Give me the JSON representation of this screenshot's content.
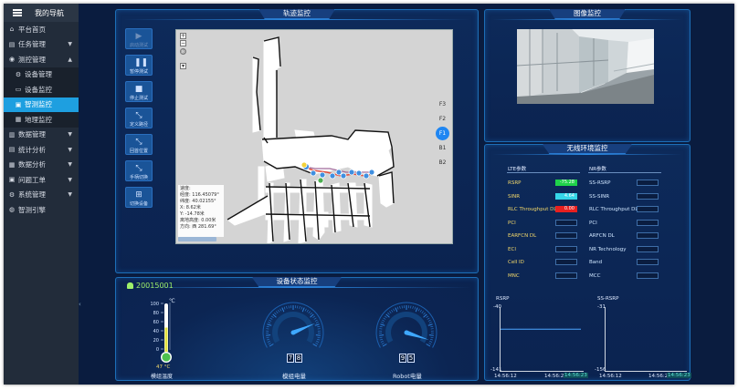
{
  "sidebar": {
    "title": "我的导航",
    "items": [
      {
        "label": "平台首页",
        "icon": "home-icon",
        "level": 0,
        "caret": false,
        "active": false
      },
      {
        "label": "任务管理",
        "icon": "task-icon",
        "level": 0,
        "caret": true,
        "caret_dir": "down",
        "active": false
      },
      {
        "label": "测控管理",
        "icon": "monitor-icon",
        "level": 0,
        "caret": true,
        "caret_dir": "up",
        "active": false
      },
      {
        "label": "设备管理",
        "icon": "device-icon",
        "level": 1,
        "caret": false,
        "active": false
      },
      {
        "label": "设备监控",
        "icon": "device-monitor-icon",
        "level": 1,
        "caret": false,
        "active": false
      },
      {
        "label": "智测监控",
        "icon": "smart-monitor-icon",
        "level": 1,
        "caret": false,
        "active": true
      },
      {
        "label": "地理监控",
        "icon": "geo-monitor-icon",
        "level": 1,
        "caret": false,
        "active": false
      },
      {
        "label": "数据管理",
        "icon": "data-icon",
        "level": 0,
        "caret": true,
        "caret_dir": "down",
        "active": false
      },
      {
        "label": "统计分析",
        "icon": "stats-icon",
        "level": 0,
        "caret": true,
        "caret_dir": "down",
        "active": false
      },
      {
        "label": "数据分析",
        "icon": "analysis-icon",
        "level": 0,
        "caret": true,
        "caret_dir": "down",
        "active": false
      },
      {
        "label": "问题工单",
        "icon": "ticket-icon",
        "level": 0,
        "caret": true,
        "caret_dir": "down",
        "active": false
      },
      {
        "label": "系统管理",
        "icon": "gear-icon",
        "level": 0,
        "caret": true,
        "caret_dir": "down",
        "active": false
      },
      {
        "label": "智测引擎",
        "icon": "engine-icon",
        "level": 0,
        "caret": false,
        "active": false
      }
    ]
  },
  "track_panel": {
    "title": "轨迹监控",
    "buttons": [
      {
        "label": "启动测试",
        "icon": "play-icon",
        "disabled": true
      },
      {
        "label": "暂停测试",
        "icon": "pause-icon",
        "disabled": false
      },
      {
        "label": "停止测试",
        "icon": "stop-icon",
        "disabled": false
      },
      {
        "label": "定义路径",
        "icon": "path-icon",
        "disabled": false
      },
      {
        "label": "回首位置",
        "icon": "home-position-icon",
        "disabled": false
      },
      {
        "label": "手柄切换",
        "icon": "joystick-icon",
        "disabled": false
      },
      {
        "label": "切换设备",
        "icon": "switch-device-icon",
        "disabled": false
      }
    ],
    "floors": [
      "F3",
      "F2",
      "F1",
      "B1",
      "B2"
    ],
    "active_floor": "F1",
    "info": {
      "speed": "速度:",
      "lng": "经度: 116.45079°",
      "lat": "纬度: 40.02155°",
      "x": "X: 8.62米",
      "y": "Y: -14.78米",
      "height": "离地高度: 0.00米",
      "heading": "方向: 西 281.69°"
    }
  },
  "image_panel": {
    "title": "图像监控"
  },
  "wireless_panel": {
    "title": "无线环境监控",
    "lte_header": "LTE参数",
    "nr_header": "NR参数",
    "lte": [
      {
        "label": "RSRP",
        "value": "-75.28",
        "color": "#1fd24a"
      },
      {
        "label": "SINR",
        "value": "4.64",
        "color": "#36d6e8"
      },
      {
        "label": "RLC Throughput DL",
        "value": "0.00",
        "color": "#e82020"
      },
      {
        "label": "PCI",
        "value": "",
        "color": ""
      },
      {
        "label": "EARFCN DL",
        "value": "",
        "color": ""
      },
      {
        "label": "ECI",
        "value": "",
        "color": ""
      },
      {
        "label": "Cell ID",
        "value": "",
        "color": ""
      },
      {
        "label": "MNC",
        "value": "",
        "color": ""
      }
    ],
    "nr": [
      {
        "label": "SS-RSRP",
        "value": ""
      },
      {
        "label": "SS-SINR",
        "value": ""
      },
      {
        "label": "RLC Throughput DL",
        "value": ""
      },
      {
        "label": "PCI",
        "value": ""
      },
      {
        "label": "ARFCN DL",
        "value": ""
      },
      {
        "label": "NR Technology",
        "value": ""
      },
      {
        "label": "Band",
        "value": ""
      },
      {
        "label": "MCC",
        "value": ""
      }
    ],
    "charts": [
      {
        "title": "RSRP",
        "ymax": "-40",
        "ymin": "-141",
        "t_start": "14:56:12",
        "t_end": "14:56:23",
        "t_current": "14:56:23",
        "values": [
          -75,
          -75,
          -75,
          -75,
          -75,
          -75,
          -75,
          -75,
          -75,
          -75,
          -75,
          -75
        ]
      },
      {
        "title": "SS-RSRP",
        "ymax": "-31",
        "ymin": "-156",
        "t_start": "14:56:12",
        "t_end": "14:56:2",
        "t_current": "14:56:23",
        "values": []
      }
    ]
  },
  "device_panel": {
    "title": "设备状态监控",
    "device_id": "20015001",
    "thermo": {
      "unit": "℃",
      "ticks": [
        "100",
        "80",
        "60",
        "40",
        "20",
        "0"
      ],
      "value": 47,
      "value_label": "47 °C",
      "label": "模组温度"
    },
    "gauges": [
      {
        "label": "模组电量",
        "digits": [
          "7",
          "8"
        ],
        "value": 78
      },
      {
        "label": "Robot电量",
        "digits": [
          "9",
          "5"
        ],
        "value": 95
      }
    ]
  }
}
